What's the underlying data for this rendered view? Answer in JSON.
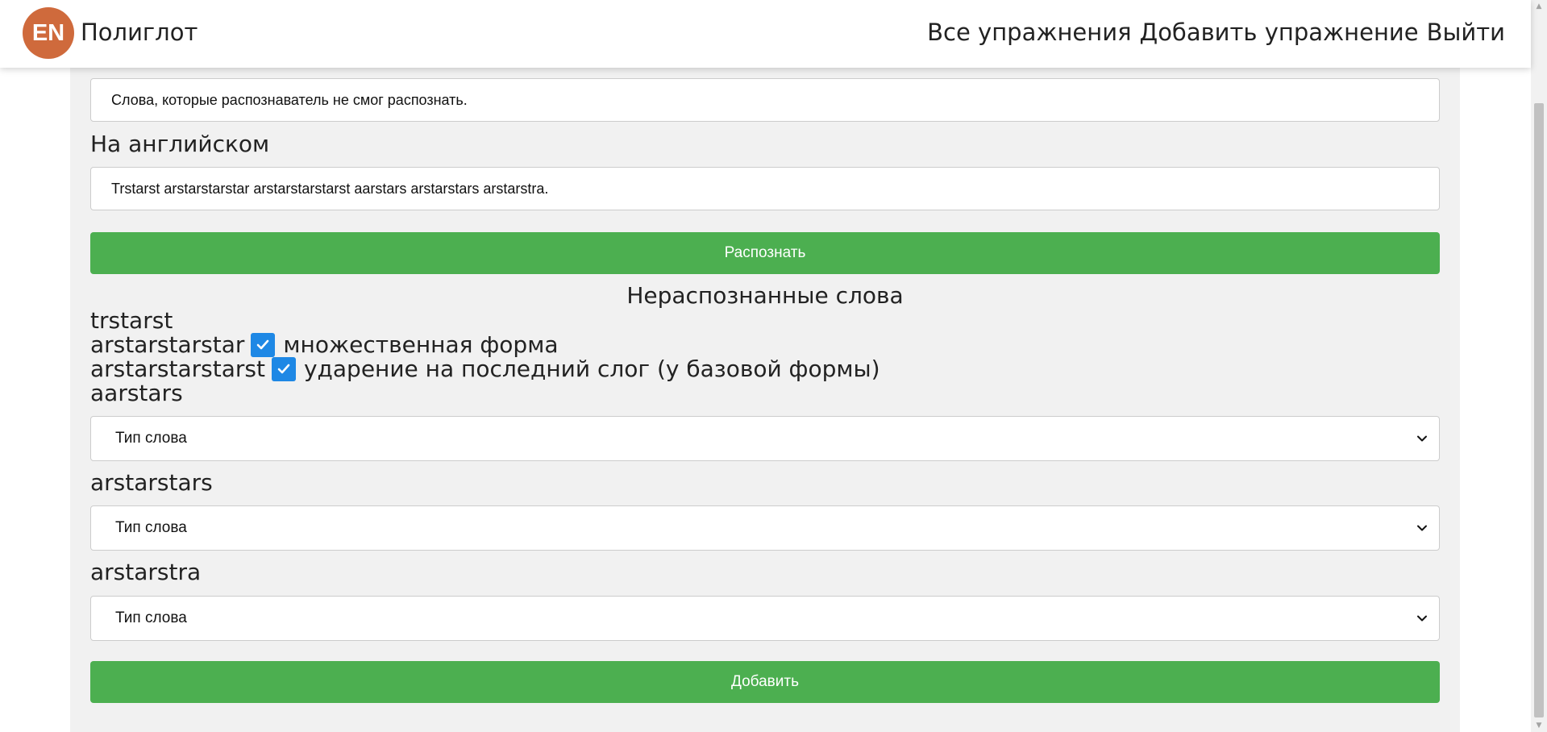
{
  "header": {
    "logo_text": "EN",
    "brand_name": "Полиглот",
    "nav": {
      "all_exercises": "Все упражнения",
      "add_exercise": "Добавить упражнение",
      "logout": "Выйти"
    }
  },
  "form": {
    "russian_text_value": "Слова, которые распознаватель не смог распознать.",
    "english_label": "На английском",
    "english_text_value": "Trstarst arstarstarstar arstarstarstarst aarstars arstarstars arstarstra.",
    "recognize_button": "Распознать",
    "unrecognized_heading": "Нераспознанные слова",
    "words": [
      {
        "word": "trstarst"
      },
      {
        "word": "arstarstarstar",
        "checkbox_checked": true,
        "checkbox_label": "множественная форма"
      },
      {
        "word": "arstarstarstarst",
        "checkbox_checked": true,
        "checkbox_label": "ударение на последний слог (у базовой формы)"
      },
      {
        "word": "aarstars",
        "select_value": "Тип слова"
      },
      {
        "word": "arstarstars",
        "select_value": "Тип слова"
      },
      {
        "word": "arstarstra",
        "select_value": "Тип слова"
      }
    ],
    "add_button": "Добавить"
  },
  "colors": {
    "accent_green": "#4caf50",
    "logo_orange": "#cf6a3c",
    "checkbox_blue": "#1e88e5",
    "panel_background": "#f1f1f1"
  }
}
